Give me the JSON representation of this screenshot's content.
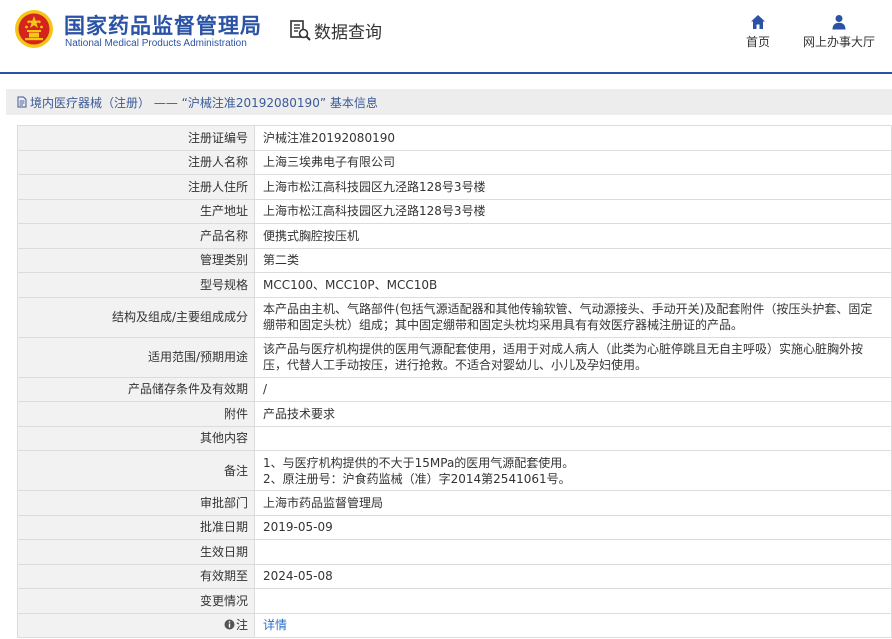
{
  "header": {
    "org_name_cn": "国家药品监督管理局",
    "org_name_en": "National Medical Products Administration",
    "query_label": "数据查询",
    "nav": {
      "home_label": "首页",
      "hall_label": "网上办事大厅"
    }
  },
  "breadcrumb": {
    "text": "境内医疗器械（注册） —— “沪械注准20192080190” 基本信息"
  },
  "record": {
    "rows": [
      {
        "label": "注册证编号",
        "value": "沪械注准20192080190"
      },
      {
        "label": "注册人名称",
        "value": "上海三埃弗电子有限公司"
      },
      {
        "label": "注册人住所",
        "value": "上海市松江高科技园区九泾路128号3号楼"
      },
      {
        "label": "生产地址",
        "value": "上海市松江高科技园区九泾路128号3号楼"
      },
      {
        "label": "产品名称",
        "value": "便携式胸腔按压机"
      },
      {
        "label": "管理类别",
        "value": "第二类"
      },
      {
        "label": "型号规格",
        "value": "MCC100、MCC10P、MCC10B"
      },
      {
        "label": "结构及组成/主要组成成分",
        "value": "本产品由主机、气路部件(包括气源适配器和其他传输软管、气动源接头、手动开关)及配套附件（按压头护套、固定绷带和固定头枕）组成；其中固定绷带和固定头枕均采用具有有效医疗器械注册证的产品。"
      },
      {
        "label": "适用范围/预期用途",
        "value": "该产品与医疗机构提供的医用气源配套使用，适用于对成人病人（此类为心脏停跳且无自主呼吸）实施心脏胸外按压，代替人工手动按压，进行抢救。不适合对婴幼儿、小儿及孕妇使用。"
      },
      {
        "label": "产品储存条件及有效期",
        "value": "/"
      },
      {
        "label": "附件",
        "value": "产品技术要求"
      },
      {
        "label": "其他内容",
        "value": ""
      },
      {
        "label": "备注",
        "lines": [
          "1、与医疗机构提供的不大于15MPa的医用气源配套使用。",
          "2、原注册号：沪食药监械（准）字2014第2541061号。"
        ]
      },
      {
        "label": "审批部门",
        "value": "上海市药品监督管理局"
      },
      {
        "label": "批准日期",
        "value": "2019-05-09"
      },
      {
        "label": "生效日期",
        "value": ""
      },
      {
        "label": "有效期至",
        "value": "2024-05-08"
      },
      {
        "label": "变更情况",
        "value": ""
      },
      {
        "label": "注",
        "value": "详情"
      }
    ]
  },
  "colors": {
    "brand_blue": "#2a53a5",
    "link_blue": "#2a6fc9",
    "emblem_red": "#d4241c",
    "emblem_gold": "#f5c518"
  },
  "icons": {
    "emblem": "national-emblem-icon",
    "query": "search-document-icon",
    "home": "home-icon",
    "hall": "user-icon",
    "breadcrumb": "document-icon",
    "note": "info-icon"
  }
}
